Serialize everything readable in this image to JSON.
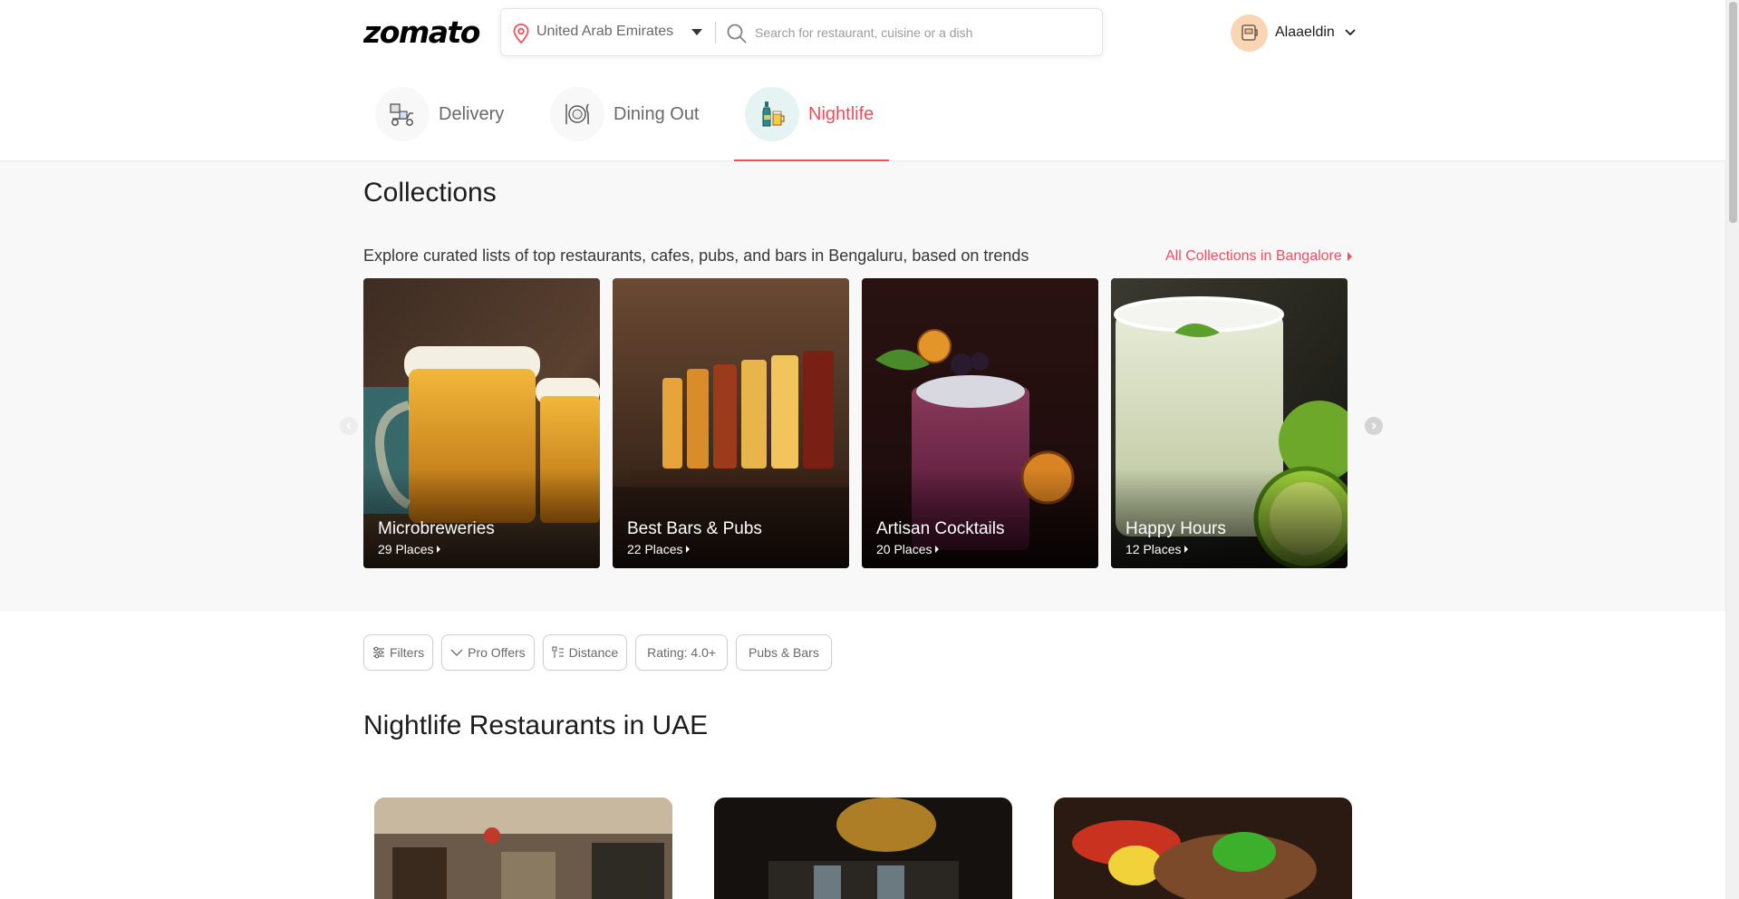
{
  "header": {
    "logo": "zomato",
    "location": "United Arab Emirates",
    "search_placeholder": "Search for restaurant, cuisine or a dish",
    "user_name": "Alaaeldin"
  },
  "tabs": [
    {
      "label": "Delivery",
      "icon": "delivery-icon",
      "active": false
    },
    {
      "label": "Dining Out",
      "icon": "dining-out-icon",
      "active": false
    },
    {
      "label": "Nightlife",
      "icon": "nightlife-icon",
      "active": true
    }
  ],
  "collections": {
    "title": "Collections",
    "subtitle": "Explore curated lists of top restaurants, cafes, pubs, and bars in Bengaluru, based on trends",
    "link": "All Collections in Bangalore",
    "items": [
      {
        "title": "Microbreweries",
        "count": "29 Places"
      },
      {
        "title": "Best Bars & Pubs",
        "count": "22 Places"
      },
      {
        "title": "Artisan Cocktails",
        "count": "20 Places"
      },
      {
        "title": "Happy Hours",
        "count": "12 Places"
      }
    ]
  },
  "filters": [
    {
      "label": "Filters",
      "icon": "filter-sliders-icon"
    },
    {
      "label": "Pro Offers",
      "icon": "pro-offers-icon"
    },
    {
      "label": "Distance",
      "icon": "distance-sort-icon"
    },
    {
      "label": "Rating: 4.0+"
    },
    {
      "label": "Pubs & Bars"
    }
  ],
  "listing": {
    "title": "Nightlife Restaurants in UAE"
  },
  "colors": {
    "accent": "#ef4f5f",
    "collections_bg": "#f8f8f8"
  }
}
